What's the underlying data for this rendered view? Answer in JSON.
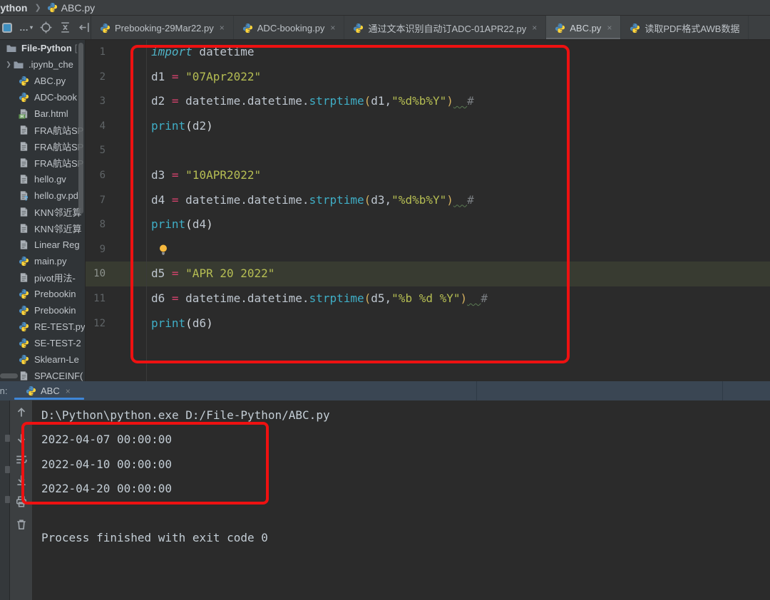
{
  "colors": {
    "annotation_red": "#EE1111",
    "run_tab_underline_blue": "#3E86D8",
    "panel_bg": "#3C3F41",
    "editor_bg": "#2B2B2B",
    "active_tab_bg": "#4C5052",
    "run_header_bg": "#3A4653",
    "current_line_bg": "#383B31",
    "string_color": "#B6BE53",
    "keyword_color": "#4FB3C6",
    "operator_color": "#D6436E"
  },
  "breadcrumb": {
    "project": "Python",
    "separator": "❯",
    "file": "ABC.py"
  },
  "tabbar": {
    "tool_icons": [
      "project-tool-icon",
      "more-options-icon",
      "locate-file-icon",
      "collapse-all-icon",
      "hide-panel-icon"
    ],
    "tabs": [
      {
        "label": "Prebooking-29Mar22.py",
        "active": false,
        "close": "×"
      },
      {
        "label": "ADC-booking.py",
        "active": false,
        "close": "×"
      },
      {
        "label": "通过文本识别自动订ADC-01APR22.py",
        "active": false,
        "close": "×"
      },
      {
        "label": "ABC.py",
        "active": true,
        "close": "×"
      },
      {
        "label": "读取PDF格式AWB数据",
        "active": false,
        "close": ""
      }
    ]
  },
  "sidebar": {
    "items": [
      {
        "label": "File-Python",
        "icon": "folder",
        "bold": true,
        "suffix": "[",
        "chevron": false
      },
      {
        "label": ".ipynb_che",
        "icon": "folder",
        "bold": false,
        "suffix": "",
        "chevron": true
      },
      {
        "label": "ABC.py",
        "icon": "py"
      },
      {
        "label": "ADC-book",
        "icon": "py"
      },
      {
        "label": "Bar.html",
        "icon": "html"
      },
      {
        "label": "FRA航站SP",
        "icon": "txt"
      },
      {
        "label": "FRA航站SP",
        "icon": "txt"
      },
      {
        "label": "FRA航站SP",
        "icon": "txt"
      },
      {
        "label": "hello.gv",
        "icon": "txt"
      },
      {
        "label": "hello.gv.pd",
        "icon": "unk"
      },
      {
        "label": "KNN邻近算",
        "icon": "txt"
      },
      {
        "label": "KNN邻近算",
        "icon": "txt"
      },
      {
        "label": "Linear Reg",
        "icon": "txt"
      },
      {
        "label": "main.py",
        "icon": "py"
      },
      {
        "label": "pivot用法-",
        "icon": "txt"
      },
      {
        "label": "Prebookin",
        "icon": "py"
      },
      {
        "label": "Prebookin",
        "icon": "py"
      },
      {
        "label": "RE-TEST.py",
        "icon": "py"
      },
      {
        "label": "SE-TEST-2",
        "icon": "py"
      },
      {
        "label": "Sklearn-Le",
        "icon": "py"
      },
      {
        "label": "SPACEINF(",
        "icon": "txt"
      }
    ]
  },
  "editor": {
    "lines": [
      {
        "n": "1",
        "tokens": [
          [
            "kw",
            "import"
          ],
          [
            "pl",
            " datetime"
          ]
        ]
      },
      {
        "n": "2",
        "tokens": [
          [
            "pl",
            "d1 "
          ],
          [
            "op",
            "= "
          ],
          [
            "str",
            "\"07Apr2022\""
          ]
        ]
      },
      {
        "n": "3",
        "tokens": [
          [
            "pl",
            "d2 "
          ],
          [
            "op",
            "= "
          ],
          [
            "pl",
            "datetime.datetime."
          ],
          [
            "fn",
            "strptime"
          ],
          [
            "par",
            "("
          ],
          [
            "pl",
            "d1,"
          ],
          [
            "str",
            "\"%d%b%Y\""
          ],
          [
            "par",
            ")"
          ],
          [
            "sq",
            "  "
          ],
          [
            "com",
            "#"
          ]
        ]
      },
      {
        "n": "4",
        "tokens": [
          [
            "fn",
            "print"
          ],
          [
            "parw",
            "("
          ],
          [
            "pl",
            "d2"
          ],
          [
            "parw",
            ")"
          ]
        ]
      },
      {
        "n": "5",
        "tokens": []
      },
      {
        "n": "6",
        "tokens": [
          [
            "pl",
            "d3 "
          ],
          [
            "op",
            "= "
          ],
          [
            "str",
            "\"10APR2022\""
          ]
        ]
      },
      {
        "n": "7",
        "tokens": [
          [
            "pl",
            "d4 "
          ],
          [
            "op",
            "= "
          ],
          [
            "pl",
            "datetime.datetime."
          ],
          [
            "fn",
            "strptime"
          ],
          [
            "par",
            "("
          ],
          [
            "pl",
            "d3,"
          ],
          [
            "str",
            "\"%d%b%Y\""
          ],
          [
            "par",
            ")"
          ],
          [
            "sq",
            "  "
          ],
          [
            "com",
            "#"
          ]
        ]
      },
      {
        "n": "8",
        "tokens": [
          [
            "fn",
            "print"
          ],
          [
            "parw",
            "("
          ],
          [
            "pl",
            "d4"
          ],
          [
            "parw",
            ")"
          ]
        ]
      },
      {
        "n": "9",
        "tokens": [],
        "bulb": true
      },
      {
        "n": "10",
        "tokens": [
          [
            "pl",
            "d5 "
          ],
          [
            "op",
            "= "
          ],
          [
            "str",
            "\"APR 20 2022\""
          ]
        ],
        "hl": true
      },
      {
        "n": "11",
        "tokens": [
          [
            "pl",
            "d6 "
          ],
          [
            "op",
            "= "
          ],
          [
            "pl",
            "datetime.datetime."
          ],
          [
            "fn",
            "strptime"
          ],
          [
            "par",
            "("
          ],
          [
            "pl",
            "d5,"
          ],
          [
            "str",
            "\"%b %d %Y\""
          ],
          [
            "par",
            ")"
          ],
          [
            "sq",
            "  "
          ],
          [
            "com",
            "#"
          ]
        ]
      },
      {
        "n": "12",
        "tokens": [
          [
            "fn",
            "print"
          ],
          [
            "parw",
            "("
          ],
          [
            "pl",
            "d6"
          ],
          [
            "parw",
            ")"
          ]
        ]
      }
    ]
  },
  "run_panel": {
    "label": "Run:",
    "tab": {
      "label": "ABC",
      "close": "×"
    },
    "toolbar_icons": [
      "up-arrow-icon",
      "down-arrow-icon",
      "soft-wrap-icon",
      "scroll-to-end-icon",
      "print-icon",
      "clear-console-icon"
    ]
  },
  "console": {
    "lines": [
      "D:\\Python\\python.exe D:/File-Python/ABC.py",
      "2022-04-07 00:00:00",
      "2022-04-10 00:00:00",
      "2022-04-20 00:00:00",
      "",
      "Process finished with exit code 0"
    ]
  }
}
